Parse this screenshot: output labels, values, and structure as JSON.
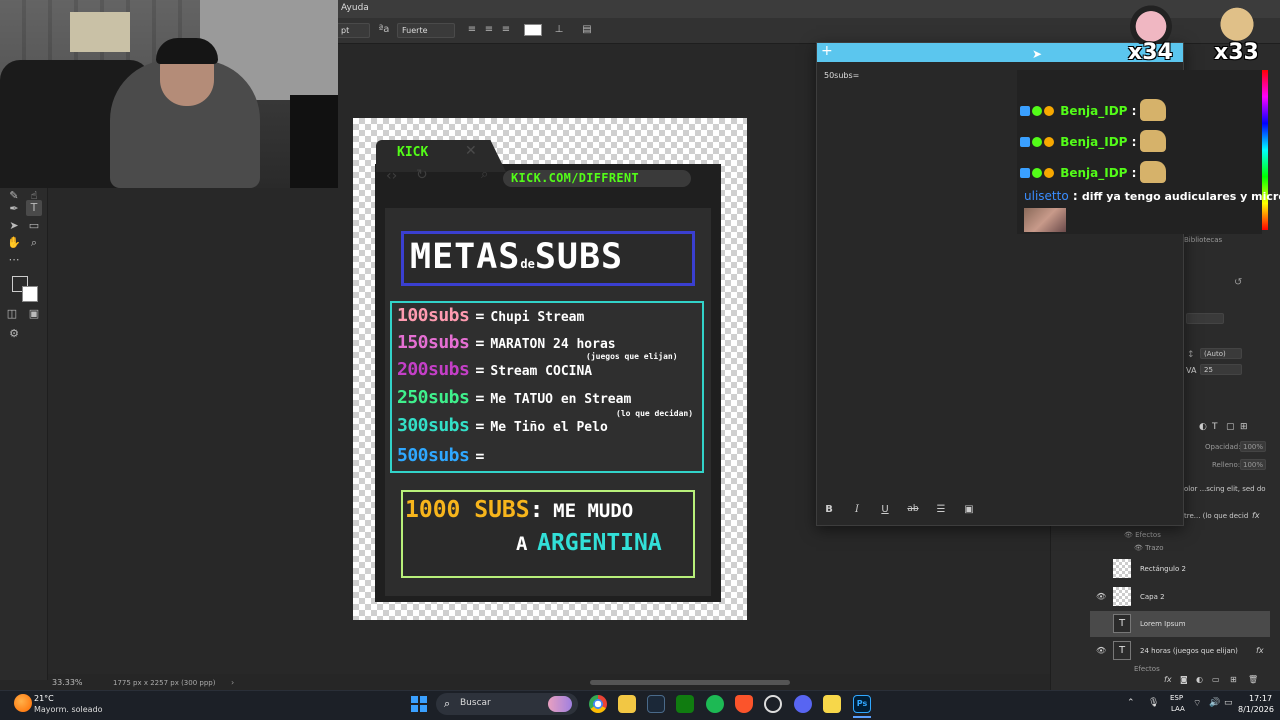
{
  "photoshop": {
    "menu": {
      "help": "Ayuda"
    },
    "options": {
      "size_unit": "pt",
      "antialias": "Fuerte",
      "text_color": "#ffffff"
    },
    "status": {
      "zoom": "33.33%",
      "doc_size": "1775 px x 2257 px (300 ppp)"
    },
    "character": {
      "leading": "(Auto)",
      "tracking": "25"
    },
    "panels": {
      "libraries": "Bibliotecas",
      "opacity_label": "Opacidad:",
      "opacity_value": "100%",
      "fill_label": "Relleno:",
      "fill_value": "100%",
      "layer_header_1": "olor ...scing elit, sed do",
      "layer_header_2": "tre... (lo que decid",
      "effects": "Efectos",
      "stroke": "Trazo",
      "layers": [
        {
          "name": "Rectángulo 2",
          "type": "shape",
          "visible": true
        },
        {
          "name": "Capa 2",
          "type": "shape",
          "visible": true
        },
        {
          "name": "Lorem Ipsum",
          "type": "text",
          "visible": false,
          "selected": true
        },
        {
          "name": "24 horas (juegos que elijan)",
          "type": "text",
          "visible": true,
          "fx": "fx"
        }
      ],
      "bottom_effects": "Efectos"
    }
  },
  "poster": {
    "tab_label": "KICK",
    "url": "KICK.COM/DIFFRENT",
    "title_a": "METAS",
    "title_de": "de",
    "title_b": "SUBS",
    "goals": [
      {
        "num": "100subs",
        "eq": "=",
        "text": "Chupi Stream",
        "color": "#ff9bb0"
      },
      {
        "num": "150subs",
        "eq": "=",
        "text": "MARATON 24 horas",
        "color": "#e56fd3"
      },
      {
        "num": "200subs",
        "eq": "=",
        "text": "Stream COCINA",
        "color": "#c43fc7"
      },
      {
        "num": "250subs",
        "eq": "=",
        "text": "Me TATUO en Stream",
        "color": "#3ff08c"
      },
      {
        "num": "300subs",
        "eq": "=",
        "text": "Me Tiño el Pelo",
        "color": "#33e0c8"
      },
      {
        "num": "500subs",
        "eq": "=",
        "text": "",
        "color": "#2fa8ff"
      }
    ],
    "note_150": "(juegos que elijan)",
    "note_300": "(lo que decidan)",
    "big_num": "1000 SUBS",
    "big_colon": ":",
    "big_text": "ME MUDO",
    "big_a": "A",
    "big_country": "ARGENTINA",
    "colors": {
      "title_border": "#3a3fd0",
      "goals_border": "#32d3c9",
      "big_border": "#b8f07a",
      "gold": "#f7b51c",
      "cyan": "#32e0d8",
      "kick_green": "#53fc18"
    }
  },
  "note": {
    "plus": "+",
    "text": "50subs=",
    "toolbar": {
      "bold": "B",
      "italic": "I",
      "underline": "U",
      "strike": "ab",
      "list": "☰",
      "image": "▣"
    }
  },
  "chat": {
    "messages": [
      {
        "user": "Benja_IDP",
        "sep": ":",
        "color": "#53fc18"
      },
      {
        "user": "Benja_IDP",
        "sep": ":",
        "color": "#53fc18"
      },
      {
        "user": "Benja_IDP",
        "sep": ":",
        "color": "#53fc18"
      },
      {
        "user": "ulisetto",
        "sep": ":",
        "text": "diff ya tengo audiculares y micro",
        "color": "#3a8dff"
      }
    ]
  },
  "emote_counters": [
    {
      "count": "x34"
    },
    {
      "count": "x33"
    }
  ],
  "taskbar": {
    "temp": "21°C",
    "weather": "Mayorm. soleado",
    "search": "Buscar",
    "lang1": "ESP",
    "lang2": "LAA",
    "time": "17:17",
    "date": "8/1/2026"
  }
}
